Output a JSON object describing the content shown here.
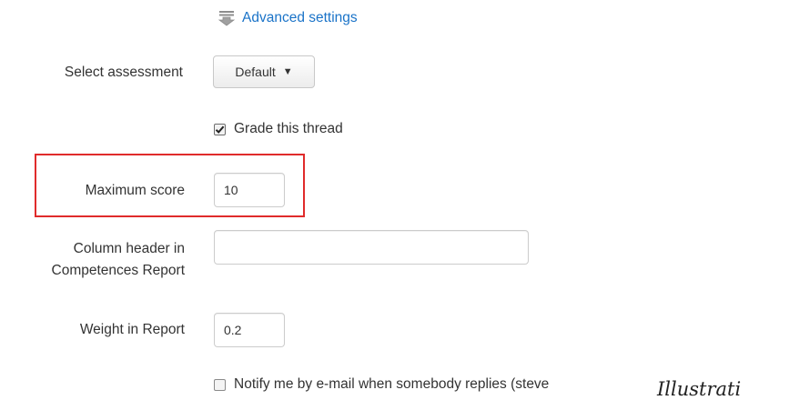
{
  "advanced_settings": {
    "label": "Advanced settings",
    "icon": "download-arrow-icon",
    "color": "#1a73c8"
  },
  "select_assessment": {
    "label": "Select assessment",
    "value": "Default"
  },
  "grade_thread": {
    "label": "Grade this thread",
    "checked": true
  },
  "maximum_score": {
    "label": "Maximum score",
    "value": "10"
  },
  "column_header": {
    "label_line1": "Column header in",
    "label_line2": "Competences Report",
    "value": ""
  },
  "weight": {
    "label": "Weight in Report",
    "value": "0.2"
  },
  "notify": {
    "label": "Notify me by e-mail when somebody replies (steve",
    "checked": false
  },
  "corner_text": "Illustrati",
  "highlight_color": "#e02b2b"
}
